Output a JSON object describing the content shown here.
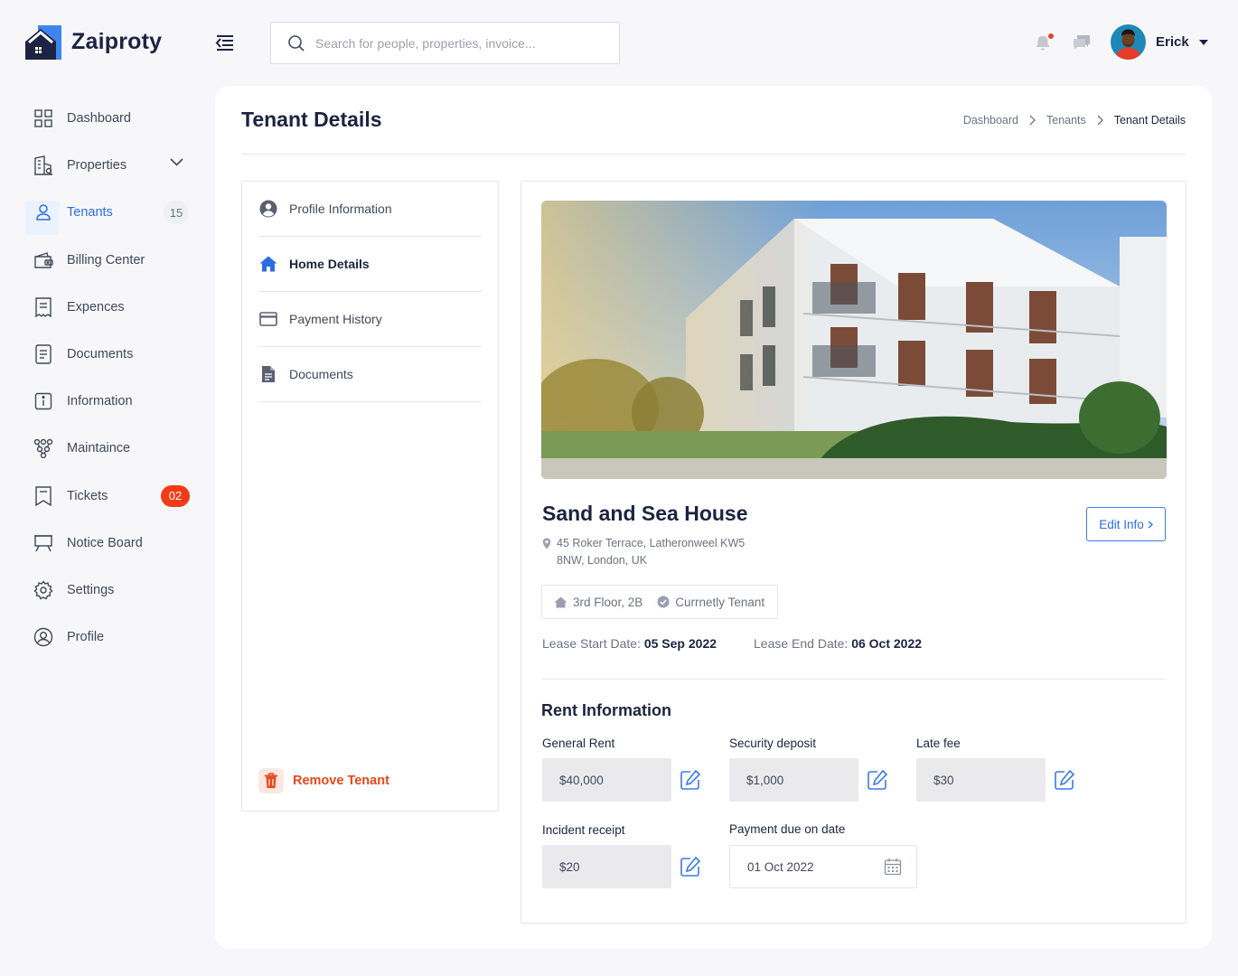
{
  "app": {
    "brand": "Zaiproty",
    "colors": {
      "accent": "#2c6ee0",
      "danger": "#f23b17",
      "text": "#1d2340"
    }
  },
  "search": {
    "placeholder": "Search for people, properties, invoice..."
  },
  "user": {
    "name": "Erick"
  },
  "sidebar": {
    "items": [
      {
        "label": "Dashboard",
        "icon": "grid-icon"
      },
      {
        "label": "Properties",
        "icon": "building-icon"
      },
      {
        "label": "Tenants",
        "icon": "user-icon",
        "count": "15"
      },
      {
        "label": "Billing Center",
        "icon": "wallet-icon"
      },
      {
        "label": "Expences",
        "icon": "receipt-icon"
      },
      {
        "label": "Documents",
        "icon": "document-icon"
      },
      {
        "label": "Information",
        "icon": "info-icon"
      },
      {
        "label": "Maintaince",
        "icon": "hierarchy-icon"
      },
      {
        "label": "Tickets",
        "icon": "ticket-icon",
        "badge": "02"
      },
      {
        "label": "Notice Board",
        "icon": "board-icon"
      },
      {
        "label": "Settings",
        "icon": "gear-icon"
      },
      {
        "label": "Profile",
        "icon": "profile-icon"
      }
    ]
  },
  "page": {
    "title": "Tenant Details",
    "breadcrumb": [
      "Dashboard",
      "Tenants",
      "Tenant Details"
    ]
  },
  "tabs": [
    {
      "label": "Profile Information"
    },
    {
      "label": "Home Details"
    },
    {
      "label": "Payment History"
    },
    {
      "label": "Documents"
    }
  ],
  "remove_label": "Remove Tenant",
  "property": {
    "name": "Sand and Sea House",
    "edit_label": "Edit Info",
    "address_line1": "45 Roker Terrace, Latheronweel KW5",
    "address_line2": "8NW, London, UK",
    "floor": "3rd Floor, 2B",
    "status": "Currnetly Tenant",
    "lease_start_label": "Lease Start Date:",
    "lease_start": "05 Sep 2022",
    "lease_end_label": "Lease End Date:",
    "lease_end": "06 Oct 2022"
  },
  "rent": {
    "title": "Rent Information",
    "general_rent_label": "General Rent",
    "general_rent": "$40,000",
    "security_label": "Security deposit",
    "security": "$1,000",
    "late_fee_label": "Late fee",
    "late_fee": "$30",
    "incident_label": "Incident receipt",
    "incident": "$20",
    "due_label": "Payment due on date",
    "due_date": "01 Oct 2022"
  }
}
